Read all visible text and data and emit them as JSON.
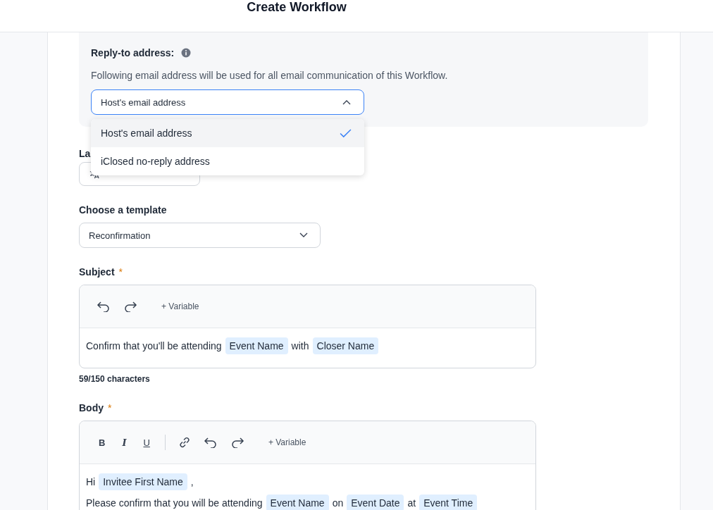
{
  "header": {
    "title": "Create Workflow"
  },
  "reply_to": {
    "label": "Reply-to address:",
    "description": "Following email address will be used for all email communication of this Workflow.",
    "value": "Host's email address",
    "expanded": true,
    "options": [
      {
        "label": "Host's email address",
        "selected": true
      },
      {
        "label": "iClosed no-reply address",
        "selected": false
      }
    ]
  },
  "language": {
    "label": "La"
  },
  "template": {
    "label": "Choose a template",
    "value": "Reconfirmation"
  },
  "subject": {
    "label": "Subject",
    "required_mark": "*",
    "variable_button": "+ Variable",
    "content": [
      {
        "kind": "text",
        "text": "Confirm that you'll be attending"
      },
      {
        "kind": "variable",
        "text": "Event Name"
      },
      {
        "kind": "text",
        "text": "with"
      },
      {
        "kind": "variable",
        "text": "Closer Name"
      }
    ],
    "counter": "59/150 characters"
  },
  "body": {
    "label": "Body",
    "required_mark": "*",
    "bold": "B",
    "italic": "I",
    "underline": "U",
    "variable_button": "+ Variable",
    "lines": [
      [
        {
          "kind": "text",
          "text": "Hi"
        },
        {
          "kind": "variable",
          "text": "Invitee First Name"
        },
        {
          "kind": "text",
          "text": ","
        }
      ],
      [
        {
          "kind": "text",
          "text": "Please confirm that you will be attending"
        },
        {
          "kind": "variable",
          "text": "Event Name"
        },
        {
          "kind": "text",
          "text": "on"
        },
        {
          "kind": "variable",
          "text": "Event Date"
        },
        {
          "kind": "text",
          "text": "at"
        },
        {
          "kind": "variable",
          "text": "Event Time"
        }
      ]
    ]
  }
}
